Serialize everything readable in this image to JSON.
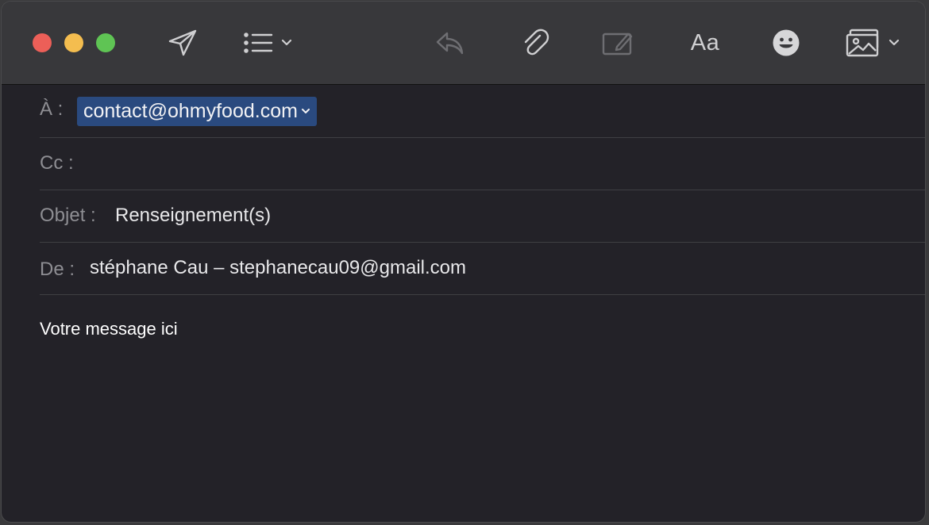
{
  "window": {
    "traffic_lights": {
      "close": "#ec5f58",
      "minimize": "#f4bd4f",
      "zoom": "#5fc454"
    }
  },
  "toolbar": {
    "send": {
      "icon": "paper-plane-icon"
    },
    "header_fields": {
      "icon": "list-bullets-icon"
    },
    "reply": {
      "icon": "reply-arrow-icon"
    },
    "attach": {
      "icon": "paperclip-icon"
    },
    "markup": {
      "icon": "markup-pencil-icon"
    },
    "format": {
      "label": "Aa"
    },
    "emoji": {
      "icon": "smiley-icon"
    },
    "photo": {
      "icon": "photo-browser-icon"
    }
  },
  "compose": {
    "to": {
      "label": "À :",
      "recipient": "contact@ohmyfood.com"
    },
    "cc": {
      "label": "Cc :",
      "value": ""
    },
    "subject": {
      "label": "Objet :",
      "value": "Renseignement(s)"
    },
    "from": {
      "label": "De :",
      "value": "stéphane Cau – stephanecau09@gmail.com"
    },
    "body": "Votre message ici"
  },
  "colors": {
    "toolbar_bg": "#38383b",
    "content_bg": "#232228",
    "token_bg": "#2a4a7f",
    "label_text": "#8e8e93",
    "value_text": "#e8e8ea"
  }
}
